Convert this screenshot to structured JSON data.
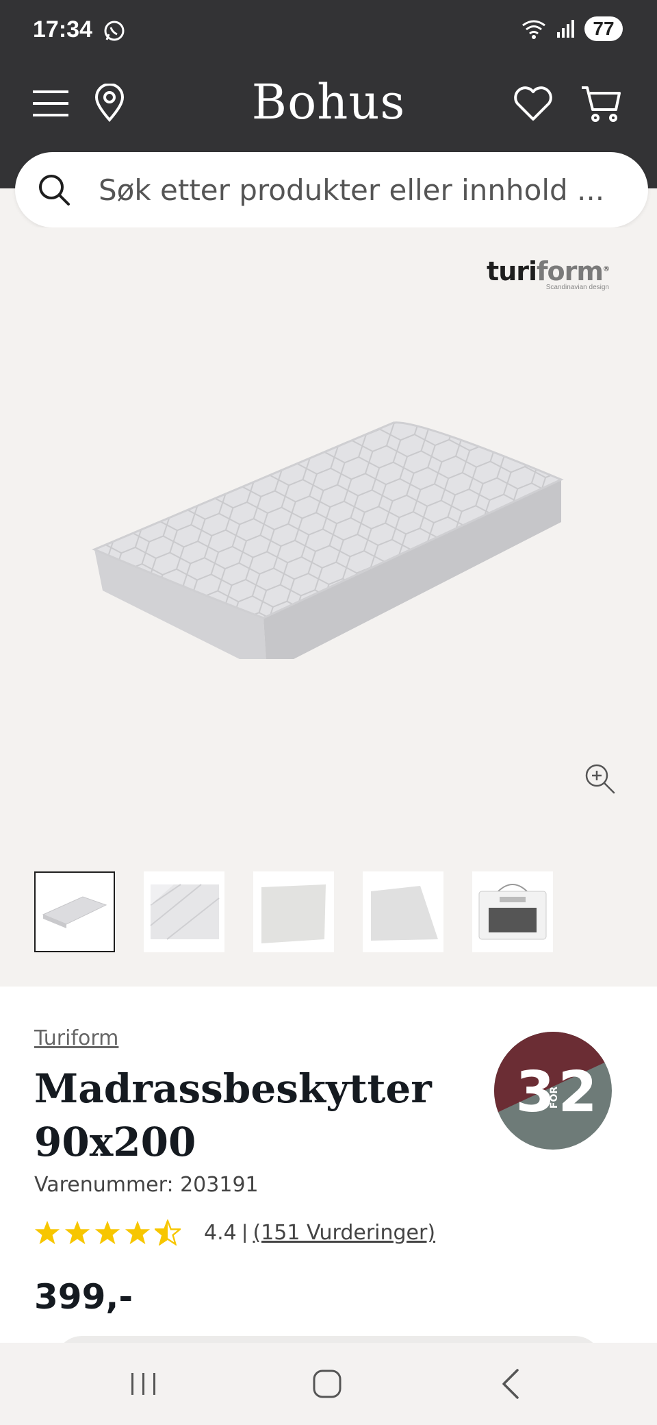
{
  "status_bar": {
    "time": "17:34",
    "battery": "77",
    "icons": [
      "whatsapp-icon",
      "wifi-icon",
      "signal-icon",
      "battery-icon"
    ]
  },
  "header": {
    "logo": "Bohus",
    "icons": [
      "menu-icon",
      "location-pin-icon",
      "heart-icon",
      "cart-icon"
    ],
    "bg_color": "#333335"
  },
  "search": {
    "placeholder": "Søk etter produkter eller innhold ..."
  },
  "gallery": {
    "brand_logo": {
      "word_dark": "turi",
      "word_grey": "form",
      "mark": "®",
      "tagline": "Scandinavian design"
    },
    "zoom_icon": "zoom-in-icon",
    "thumbnails": [
      {
        "name": "thumb-mattress-angle",
        "active": true
      },
      {
        "name": "thumb-mattress-corner",
        "active": false
      },
      {
        "name": "thumb-mattress-flat",
        "active": false
      },
      {
        "name": "thumb-mattress-top",
        "active": false
      },
      {
        "name": "thumb-packaging",
        "active": false
      }
    ]
  },
  "product": {
    "brand": "Turiform",
    "title": "Madrassbeskytter 90x200",
    "sku": "Varenummer: 203191",
    "rating": 4.4,
    "rating_text": "4.4",
    "rating_sep": "|",
    "reviews": "(151 Vurderinger)",
    "price": "399,-"
  },
  "promo": {
    "big": "3",
    "small": "FOR",
    "second": "2",
    "colors": {
      "top": "#6b2d34",
      "bottom": "#6e7b78"
    }
  },
  "nav": {
    "icons": [
      "recent-apps-icon",
      "home-icon",
      "back-icon"
    ]
  }
}
